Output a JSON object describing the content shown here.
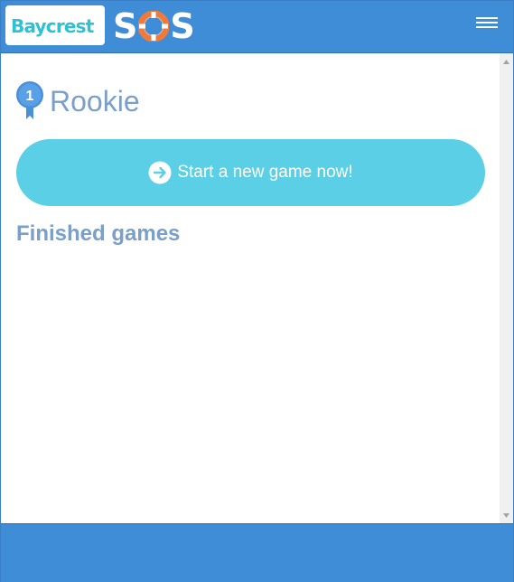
{
  "header": {
    "logo_text": "Baycrest",
    "app_name_left": "S",
    "app_name_right": "S",
    "menu_icon": "hamburger-icon"
  },
  "profile": {
    "level_number": "1",
    "rank": "Rookie",
    "badge_icon": "ribbon-badge-icon"
  },
  "actions": {
    "start_game_label": "Start a new game now!",
    "start_game_icon": "arrow-right-circle-icon"
  },
  "finished": {
    "title": "Finished games",
    "games": []
  },
  "colors": {
    "header_bg": "#3f8dd6",
    "accent_cyan": "#5bcfe6",
    "logo_cyan": "#2ec0d3",
    "text_muted_blue": "#7a9fc8",
    "buoy_orange": "#f07a3a"
  }
}
